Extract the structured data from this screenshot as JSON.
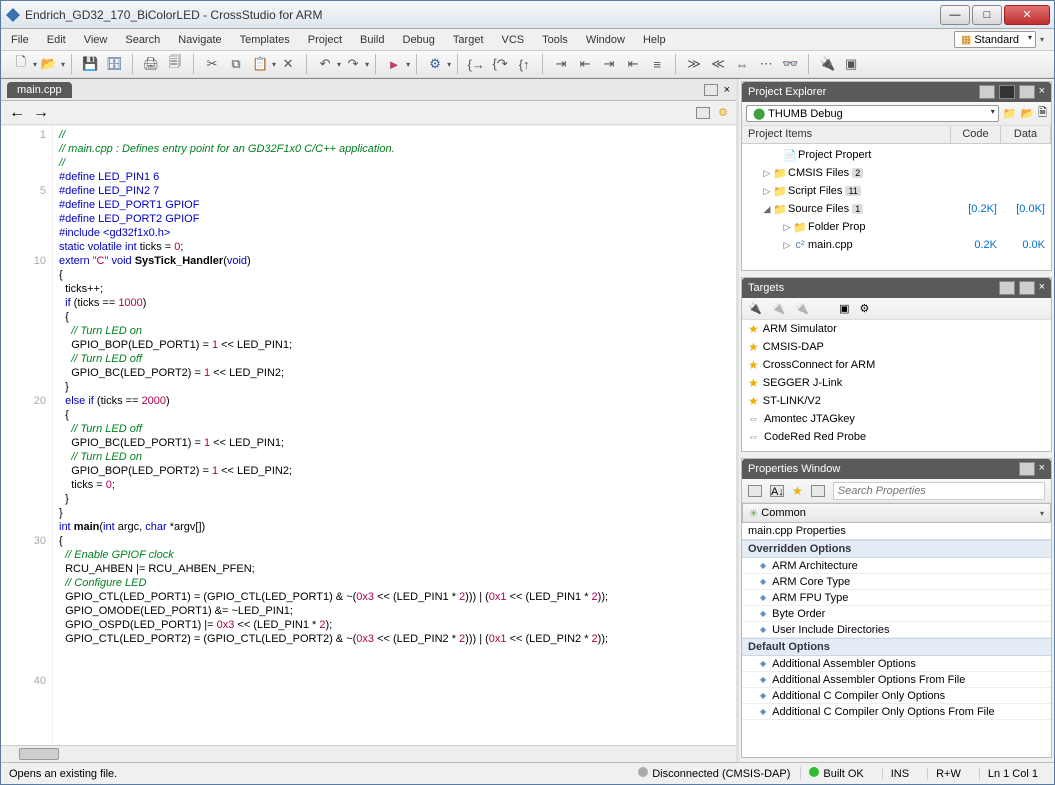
{
  "title": "Endrich_GD32_170_BiColorLED - CrossStudio for ARM",
  "menu": [
    "File",
    "Edit",
    "View",
    "Search",
    "Navigate",
    "Templates",
    "Project",
    "Build",
    "Debug",
    "Target",
    "VCS",
    "Tools",
    "Window",
    "Help"
  ],
  "menu_combo": "Standard",
  "editor": {
    "tab": "main.cpp",
    "gutter": "1\n\n\n\n5\n\n\n\n\n10\n\n\n\n\n\n\n\n\n\n20\n\n\n\n\n\n\n\n\n\n30\n\n\n\n\n\n\n\n\n\n40\n\n\n\n",
    "code_lines": [
      {
        "t": "//",
        "c": "cm"
      },
      {
        "t": "// main.cpp : Defines entry point for an GD32F1x0 C/C++ application.",
        "c": "cm"
      },
      {
        "t": "//",
        "c": "cm"
      },
      {
        "t": ""
      },
      {
        "t": "#define LED_PIN1 6",
        "c": "kw"
      },
      {
        "t": "#define LED_PIN2 7",
        "c": "kw"
      },
      {
        "t": "#define LED_PORT1 GPIOF",
        "c": "kw"
      },
      {
        "t": "#define LED_PORT2 GPIOF",
        "c": "kw"
      },
      {
        "t": ""
      },
      {
        "t": "#include <gd32f1x0.h>",
        "c": "kw"
      },
      {
        "t": ""
      },
      {
        "html": "<span class='kw'>static volatile int</span> ticks = <span class='num'>0</span>;"
      },
      {
        "t": ""
      },
      {
        "html": "<span class='kw'>extern</span> <span class='str'>\"C\"</span> <span class='kw'>void</span> <b>SysTick_Handler</b>(<span class='kw'>void</span>)"
      },
      {
        "t": "{"
      },
      {
        "t": "  ticks++;"
      },
      {
        "html": "  <span class='kw'>if</span> (ticks == <span class='num'>1000</span>)"
      },
      {
        "t": "  {"
      },
      {
        "html": "    <span class='cm'>// Turn LED on</span>"
      },
      {
        "html": "    GPIO_BOP(LED_PORT1) = <span class='num'>1</span> &lt;&lt; LED_PIN1;"
      },
      {
        "html": "    <span class='cm'>// Turn LED off</span>"
      },
      {
        "html": "    GPIO_BC(LED_PORT2) = <span class='num'>1</span> &lt;&lt; LED_PIN2;"
      },
      {
        "t": "  }"
      },
      {
        "html": "  <span class='kw'>else if</span> (ticks == <span class='num'>2000</span>)"
      },
      {
        "t": "  {"
      },
      {
        "html": "    <span class='cm'>// Turn LED off</span>"
      },
      {
        "html": "    GPIO_BC(LED_PORT1) = <span class='num'>1</span> &lt;&lt; LED_PIN1;"
      },
      {
        "html": "    <span class='cm'>// Turn LED on</span>"
      },
      {
        "html": "    GPIO_BOP(LED_PORT2) = <span class='num'>1</span> &lt;&lt; LED_PIN2;"
      },
      {
        "html": "    ticks = <span class='num'>0</span>;"
      },
      {
        "t": "  }"
      },
      {
        "t": "}"
      },
      {
        "t": ""
      },
      {
        "html": "<span class='kw'>int</span> <b>main</b>(<span class='kw'>int</span> argc, <span class='kw'>char</span> *argv[])"
      },
      {
        "t": "{"
      },
      {
        "html": "  <span class='cm'>// Enable GPIOF clock</span>"
      },
      {
        "t": "  RCU_AHBEN |= RCU_AHBEN_PFEN;"
      },
      {
        "t": ""
      },
      {
        "html": "  <span class='cm'>// Configure LED</span>"
      },
      {
        "html": "  GPIO_CTL(LED_PORT1) = (GPIO_CTL(LED_PORT1) &amp; ~(<span class='num'>0x3</span> &lt;&lt; (LED_PIN1 * <span class='num'>2</span>))) | (<span class='num'>0x1</span> &lt;&lt; (LED_PIN1 * <span class='num'>2</span>));"
      },
      {
        "t": "  GPIO_OMODE(LED_PORT1) &= ~LED_PIN1;"
      },
      {
        "html": "  GPIO_OSPD(LED_PORT1) |= <span class='num'>0x3</span> &lt;&lt; (LED_PIN1 * <span class='num'>2</span>);"
      },
      {
        "t": ""
      },
      {
        "html": "  GPIO_CTL(LED_PORT2) = (GPIO_CTL(LED_PORT2) &amp; ~(<span class='num'>0x3</span> &lt;&lt; (LED_PIN2 * <span class='num'>2</span>))) | (<span class='num'>0x1</span> &lt;&lt; (LED_PIN2 * <span class='num'>2</span>));"
      }
    ]
  },
  "project_explorer": {
    "title": "Project Explorer",
    "config": "THUMB Debug",
    "cols": {
      "items": "Project Items",
      "code": "Code",
      "data": "Data"
    },
    "rows": [
      {
        "ind": 30,
        "exp": "",
        "ico": "📄",
        "ico_cls": "",
        "label": "Project Propert",
        "c1": "",
        "c2": ""
      },
      {
        "ind": 20,
        "exp": "▷",
        "ico": "📁",
        "ico_cls": "folder-ico",
        "label": "CMSIS Files",
        "badge": "2",
        "c1": "",
        "c2": ""
      },
      {
        "ind": 20,
        "exp": "▷",
        "ico": "📁",
        "ico_cls": "folder-ico",
        "label": "Script Files",
        "badge": "11",
        "c1": "",
        "c2": ""
      },
      {
        "ind": 20,
        "exp": "◢",
        "ico": "📁",
        "ico_cls": "folder-ico",
        "label": "Source Files",
        "badge": "1",
        "c1": "[0.2K]",
        "c2": "[0.0K]"
      },
      {
        "ind": 40,
        "exp": "▷",
        "ico": "📁",
        "ico_cls": "folder-ico",
        "label": "Folder Prop",
        "c1": "",
        "c2": ""
      },
      {
        "ind": 40,
        "exp": "▷",
        "ico": "c²",
        "ico_cls": "cpp-ico",
        "label": "main.cpp",
        "c1": "0.2K",
        "c2": "0.0K"
      }
    ]
  },
  "targets": {
    "title": "Targets",
    "items": [
      {
        "star": true,
        "label": "ARM Simulator"
      },
      {
        "star": true,
        "label": "CMSIS-DAP"
      },
      {
        "star": true,
        "label": "CrossConnect for ARM"
      },
      {
        "star": true,
        "label": "SEGGER J-Link"
      },
      {
        "star": true,
        "label": "ST-LINK/V2"
      },
      {
        "star": false,
        "label": "Amontec JTAGkey"
      },
      {
        "star": false,
        "label": "CodeRed Red Probe"
      }
    ]
  },
  "properties": {
    "title": "Properties Window",
    "search_placeholder": "Search Properties",
    "combo": "Common",
    "subject": "main.cpp Properties",
    "groups": [
      {
        "name": "Overridden Options",
        "items": [
          "ARM Architecture",
          "ARM Core Type",
          "ARM FPU Type",
          "Byte Order",
          "User Include Directories"
        ]
      },
      {
        "name": "Default Options",
        "items": [
          "Additional Assembler Options",
          "Additional Assembler Options From File",
          "Additional C Compiler Only Options",
          "Additional C Compiler Only Options From File"
        ]
      }
    ]
  },
  "status": {
    "left": "Opens an existing file.",
    "disc": "Disconnected (CMSIS-DAP)",
    "built": "Built OK",
    "ins": "INS",
    "rw": "R+W",
    "pos": "Ln 1 Col 1"
  }
}
